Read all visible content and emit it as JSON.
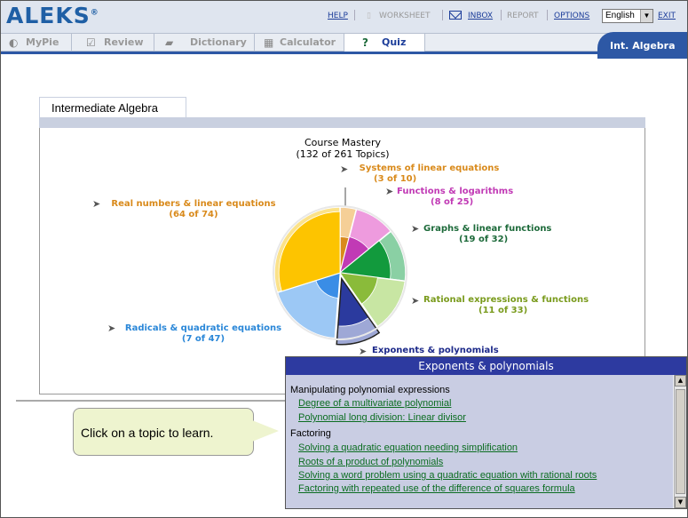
{
  "header": {
    "logo": "ALEKS",
    "logo_mark": "®",
    "links": {
      "help": "HELP",
      "worksheet": "WORKSHEET",
      "inbox": "INBOX",
      "report": "REPORT",
      "options": "OPTIONS",
      "exit": "EXIT"
    },
    "language": "English"
  },
  "tabs": [
    {
      "label": "MyPie",
      "icon": "pie-icon"
    },
    {
      "label": "Review",
      "icon": "check-icon"
    },
    {
      "label": "Dictionary",
      "icon": "book-icon"
    },
    {
      "label": "Calculator",
      "icon": "calculator-icon"
    },
    {
      "label": "Quiz",
      "icon": "quiz-icon"
    }
  ],
  "course_pill": "Int. Algebra",
  "panel": {
    "title": "Intermediate Algebra",
    "mastery_title": "Course Mastery",
    "mastery_count": "(132 of 261 Topics)"
  },
  "pie_slices": [
    {
      "name": "Systems of linear equations",
      "count": "(3 of 10)",
      "color": "#d98a1b",
      "light": "#f5cf97",
      "dark": "#d98a1b",
      "mastered": 3,
      "total": 10
    },
    {
      "name": "Functions & logarithms",
      "count": "(8 of 25)",
      "color": "#c13ab5",
      "light": "#ee9bde",
      "dark": "#c13ab5",
      "mastered": 8,
      "total": 25
    },
    {
      "name": "Graphs & linear functions",
      "count": "(19 of 32)",
      "color": "#1d6a3a",
      "light": "#8ad0a4",
      "dark": "#129a3d",
      "mastered": 19,
      "total": 32
    },
    {
      "name": "Rational expressions & functions",
      "count": "(11 of 33)",
      "color": "#7a9b1d",
      "light": "#c8e6a3",
      "dark": "#8abb3a",
      "mastered": 11,
      "total": 33
    },
    {
      "name": "Exponents & polynomials",
      "count": "",
      "color": "#1d2a8a",
      "light": "#9ea8d6",
      "dark": "#2b3a9e",
      "mastered": 14,
      "total": 27
    },
    {
      "name": "Radicals & quadratic equations",
      "count": "(7 of 47)",
      "color": "#2a87d8",
      "light": "#9cc8f5",
      "dark": "#3a8de6",
      "mastered": 7,
      "total": 47
    },
    {
      "name": "Real numbers & linear equations",
      "count": "(64 of 74)",
      "color": "#d98a1b",
      "light": "#fbe28a",
      "dark": "#fdc400",
      "mastered": 64,
      "total": 74
    }
  ],
  "popup": {
    "title": "Exponents & polynomials",
    "sections": [
      {
        "heading": "Manipulating polynomial expressions",
        "topics": [
          "Degree of a multivariate polynomial",
          "Polynomial long division: Linear divisor"
        ]
      },
      {
        "heading": "Factoring",
        "topics": [
          "Solving a quadratic equation needing simplification",
          "Roots of a product of polynomials",
          "Solving a word problem using a quadratic equation with rational roots",
          "Factoring with repeated use of the difference of squares formula"
        ]
      }
    ]
  },
  "callout": "Click on a topic to learn."
}
